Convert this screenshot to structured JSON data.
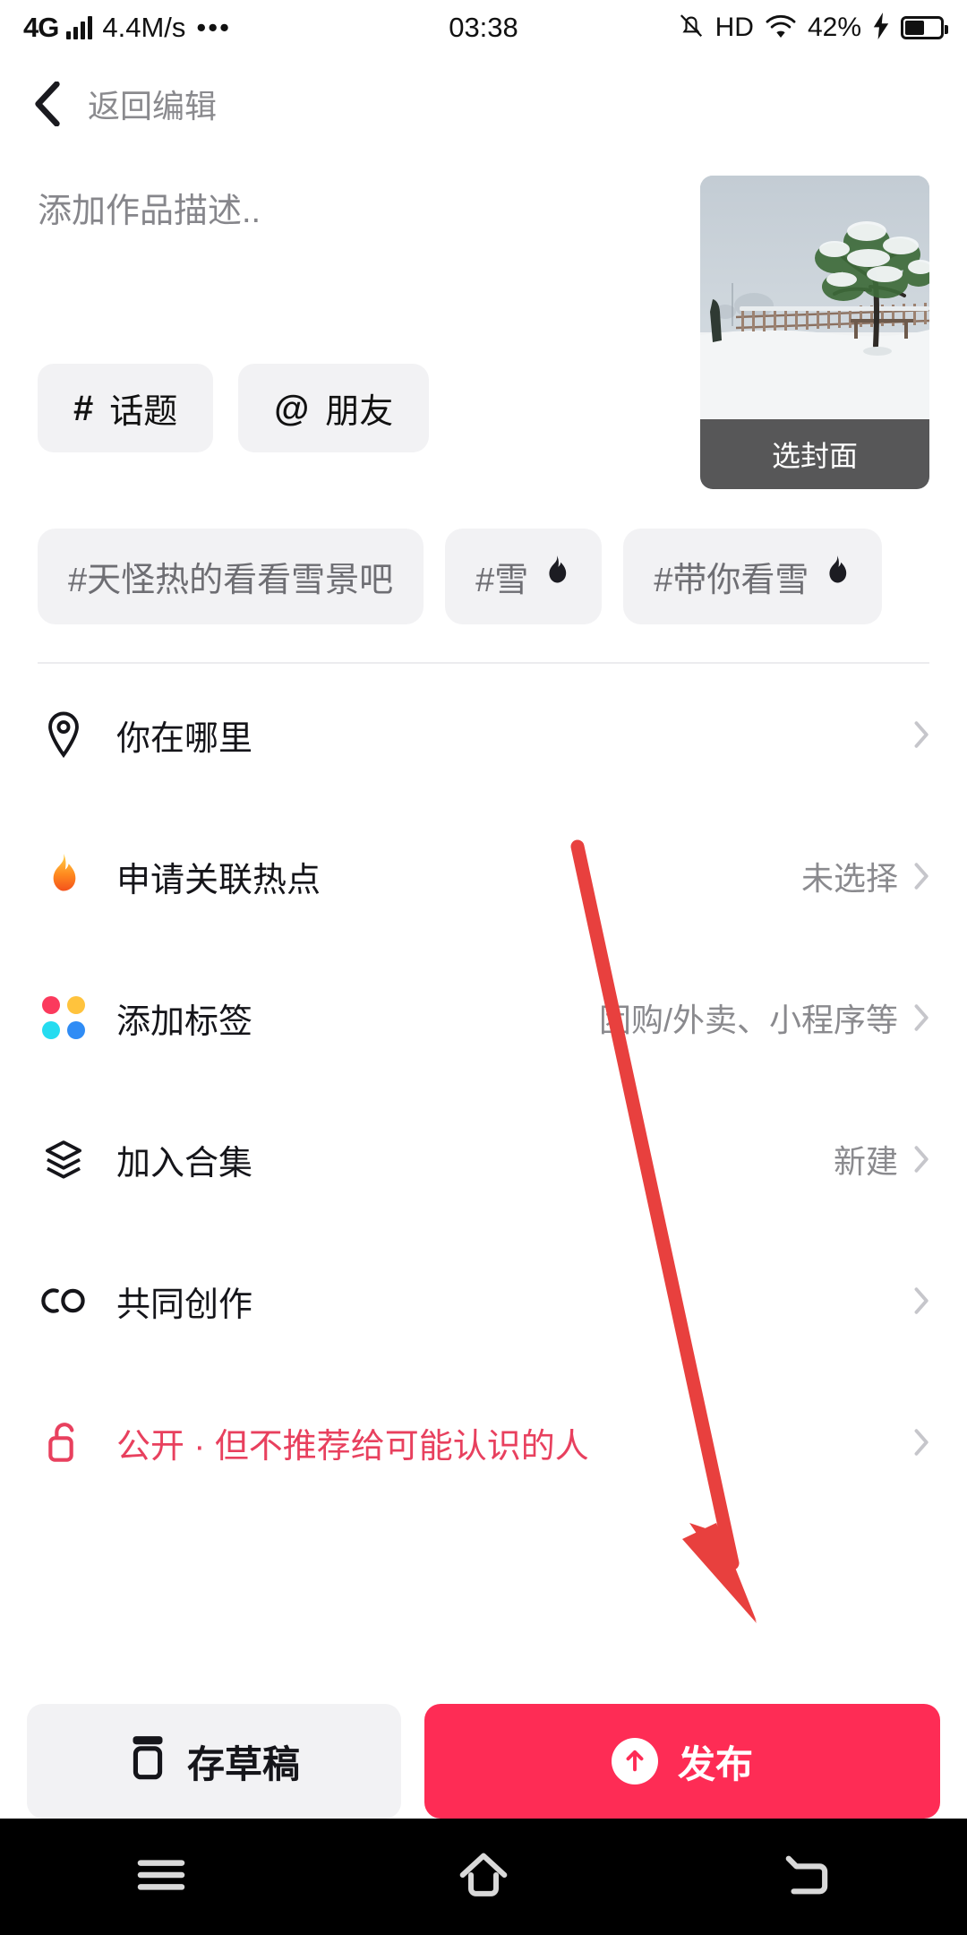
{
  "status_bar": {
    "network_type": "4G",
    "speed": "4.4M/s",
    "overflow": "•••",
    "time": "03:38",
    "hd": "HD",
    "battery_percent": "42%"
  },
  "header": {
    "back_label": "返回编辑"
  },
  "compose": {
    "description_placeholder": "添加作品描述..",
    "description_value": "",
    "chips": [
      {
        "symbol": "#",
        "label": "话题",
        "name": "topic"
      },
      {
        "symbol": "@",
        "label": "朋友",
        "name": "friend"
      }
    ],
    "cover": {
      "button_label": "选封面",
      "image_alt": "雪景"
    }
  },
  "suggested_tags": [
    {
      "text": "#天怪热的看看雪景吧",
      "hot": false
    },
    {
      "text": "#雪",
      "hot": true
    },
    {
      "text": "#带你看雪",
      "hot": true
    }
  ],
  "menu": {
    "rows": [
      {
        "icon": "location-pin-icon",
        "label": "你在哪里",
        "value": "",
        "name": "location"
      },
      {
        "icon": "flame-icon",
        "label": "申请关联热点",
        "value": "未选择",
        "name": "hotspot"
      },
      {
        "icon": "dot-grid-icon",
        "label": "添加标签",
        "value": "团购/外卖、小程序等",
        "name": "add-tag"
      },
      {
        "icon": "layers-icon",
        "label": "加入合集",
        "value": "新建",
        "name": "collection"
      },
      {
        "icon": "co-create-icon",
        "label": "共同创作",
        "value": "",
        "name": "co-create"
      },
      {
        "icon": "unlock-icon",
        "label": "公开 · 但不推荐给可能认识的人",
        "value": "",
        "name": "privacy"
      }
    ]
  },
  "actions": {
    "draft_label": "存草稿",
    "publish_label": "发布"
  },
  "navbar": {
    "recents": "menu-icon",
    "home": "home-icon",
    "back": "back-icon"
  },
  "colors": {
    "accent": "#FE2C55",
    "privacy_text": "#E8405E",
    "annotation_arrow": "#E8403E",
    "chip_bg": "#F2F2F4",
    "muted_text": "#8A8A8E"
  }
}
